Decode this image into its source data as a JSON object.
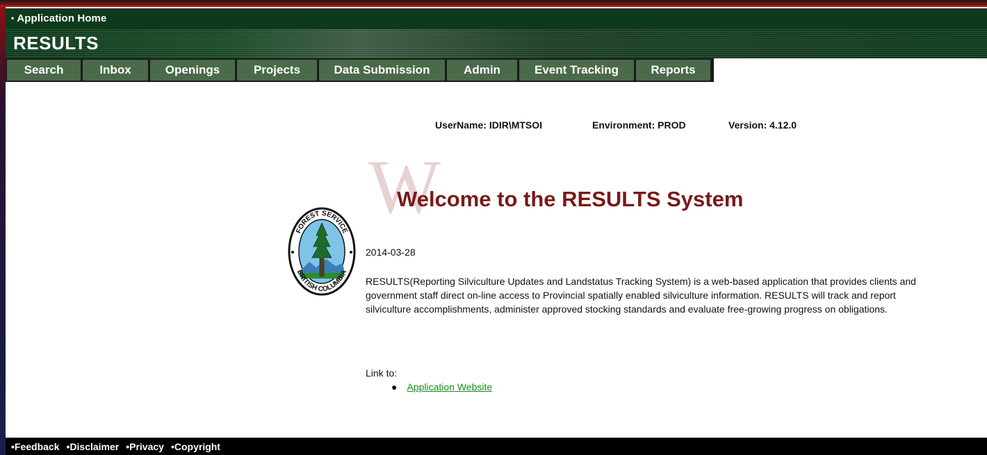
{
  "header": {
    "app_home": "Application Home",
    "title": "RESULTS"
  },
  "nav": [
    {
      "label": "Search",
      "width": 109
    },
    {
      "label": "Inbox",
      "width": 97
    },
    {
      "label": "Openings",
      "width": 125
    },
    {
      "label": "Projects",
      "width": 118
    },
    {
      "label": "Data Submission",
      "width": 184
    },
    {
      "label": "Admin",
      "width": 104
    },
    {
      "label": "Event Tracking",
      "width": 168
    },
    {
      "label": "Reports",
      "width": 110
    }
  ],
  "info": {
    "username": "UserName: IDIR\\MTSOI",
    "environment": "Environment: PROD",
    "version": "Version: 4.12.0"
  },
  "welcome": {
    "watermark_letter": "W",
    "title": "Welcome to the RESULTS System",
    "date": "2014-03-28",
    "description": "RESULTS(Reporting Silviculture Updates and Landstatus Tracking System) is a web-based application that provides clients and government staff direct on-line access to Provincial spatially enabled silviculture information. RESULTS will track and report silviculture accomplishments, administer approved stocking standards and evaluate free-growing progress on obligations.",
    "link_to": "Link to:",
    "links": [
      "Application Website"
    ]
  },
  "logo": {
    "top_text": "FOREST SERVICE",
    "bottom_text": "BRITISH COLUMBIA"
  },
  "footer": [
    "•Feedback",
    "•Disclaimer",
    "•Privacy",
    "•Copyright"
  ],
  "colors": {
    "banner_green": "#0d3a1a",
    "nav_tab": "#4a6a4a",
    "welcome_red": "#7a1a1a",
    "link_green": "#1a8a1a"
  }
}
